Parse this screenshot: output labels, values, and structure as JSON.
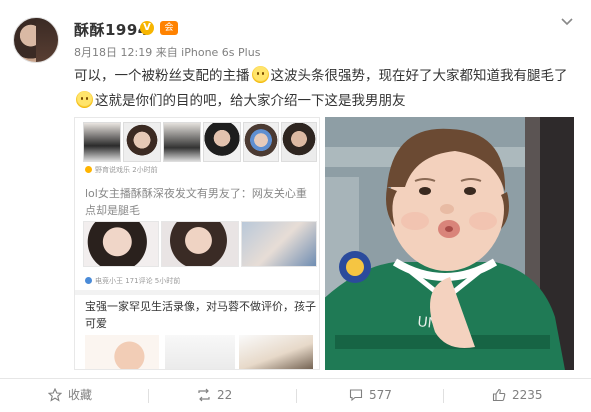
{
  "post": {
    "username": "酥酥1994",
    "vip_badge": "V",
    "vip_level": "会",
    "meta": "8月18日 12:19 来自 iPhone 6s Plus",
    "text_part1": "可以，一个被粉丝支配的主播",
    "text_part2": "这波头条很强势，现在好了大家都知道我有腿毛了",
    "text_part3": "这就是你们的目的吧，给大家介绍一下这是我男朋友"
  },
  "screenshot": {
    "source1": "野育说戏乐  2小时前",
    "headline1": "lol女主播酥酥深夜发文有男友了：网友关心重点却是腿毛",
    "source2": "电竞小王  171评论  5小时前",
    "headline2": "宝强一家罕见生活录像，对马蓉不做评价，孩子可爱"
  },
  "actions": {
    "favorite": "收藏",
    "repost": "22",
    "comment": "577",
    "like": "2235"
  },
  "colors": {
    "vip": "#f7b500",
    "level": "#ff8200",
    "text": "#333333",
    "meta": "#808080"
  }
}
